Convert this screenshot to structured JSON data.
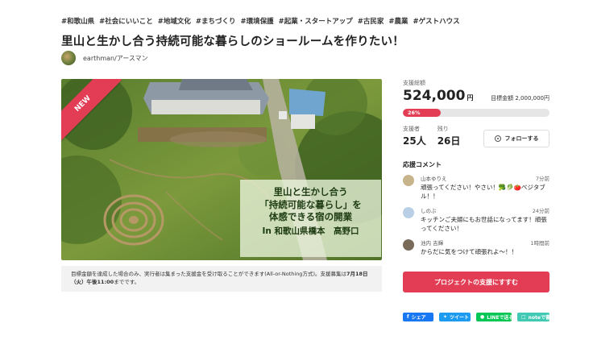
{
  "tags": [
    "#和歌山県",
    "#社会にいいこと",
    "#地域文化",
    "#まちづくり",
    "#環境保護",
    "#起業・スタートアップ",
    "#古民家",
    "#農業",
    "#ゲストハウス"
  ],
  "project": {
    "title": "里山と生かし合う持続可能な暮らしのショールームを作りたい！",
    "owner": "earthman/アースマン"
  },
  "hero": {
    "ribbon": "NEW",
    "overlay": {
      "line1": "里山と生かし合う",
      "line2": "「持続可能な暮らし」を",
      "line3": "体感できる宿の開業",
      "line4": "In 和歌山県橋本　高野口"
    }
  },
  "notice": {
    "text_before": "目標金額を達成した場合のみ、実行者は集まった支援金を受け取ることができます(All-or-Nothing方式)。支援募集は",
    "deadline": "7月18日（火）午後11:00",
    "text_after": "までです。"
  },
  "funding": {
    "label": "支援総額",
    "amount": "524,000",
    "unit": "円",
    "goal_label": "目標金額 2,000,000円",
    "progress_percent": 26,
    "progress_text": "26%",
    "supporters_label": "支援者",
    "supporters_value": "25人",
    "remaining_label": "残り",
    "remaining_value": "26日",
    "follow_label": "フォローする"
  },
  "comments": {
    "heading": "応援コメント",
    "items": [
      {
        "user": "山本ゆりえ",
        "time": "7分前",
        "text": "頑張ってください！やさい！🥦🥬🍅ベジタブル！！",
        "avatar_color": "#c8b48a"
      },
      {
        "user": "しのぶ",
        "time": "24分前",
        "text": "キッチンご夫婦にもお世話になってます！頑張ってください！",
        "avatar_color": "#b9cfe6"
      },
      {
        "user": "池内 吉輝",
        "time": "1時間前",
        "text": "からだに気をつけて頑張れよ〜！！",
        "avatar_color": "#7a6a5a"
      }
    ]
  },
  "cta_label": "プロジェクトの支援にすすむ",
  "share": {
    "facebook": "シェア",
    "twitter": "ツイート",
    "line": "LINEで送る",
    "note": "noteで書く"
  },
  "colors": {
    "accent": "#e23d55",
    "facebook": "#1877f2",
    "twitter": "#1d9bf0",
    "line": "#06c755",
    "note": "#41c9b4"
  }
}
